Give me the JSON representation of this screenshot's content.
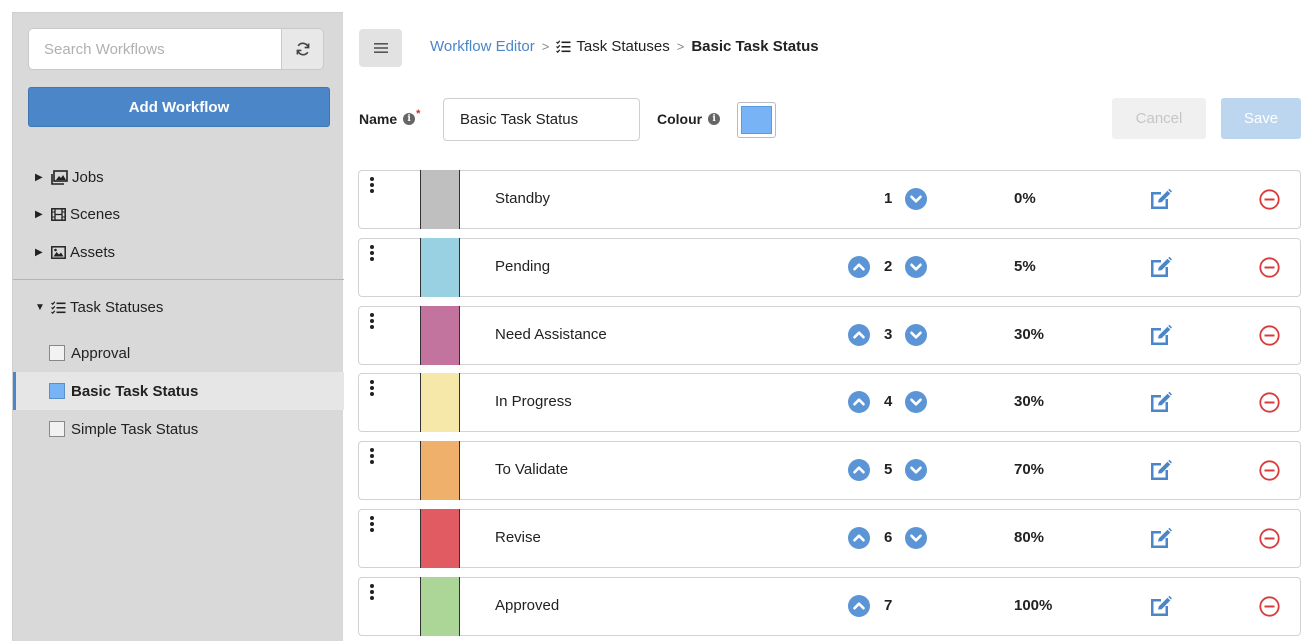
{
  "sidebar": {
    "search": {
      "placeholder": "Search Workflows",
      "value": ""
    },
    "add_workflow_label": "Add Workflow",
    "tree": [
      {
        "label": "Jobs",
        "icon": "image-stack-icon",
        "expanded": false
      },
      {
        "label": "Scenes",
        "icon": "film-icon",
        "expanded": false
      },
      {
        "label": "Assets",
        "icon": "image-icon",
        "expanded": false
      }
    ],
    "task_statuses": {
      "label": "Task Statuses",
      "icon": "checklist-icon",
      "expanded": true
    },
    "workflows": [
      {
        "label": "Approval",
        "active": false
      },
      {
        "label": "Basic Task Status",
        "active": true,
        "color": "#78b4f5"
      },
      {
        "label": "Simple Task Status",
        "active": false
      }
    ]
  },
  "breadcrumb": {
    "root": "Workflow Editor",
    "middle": "Task Statuses",
    "current": "Basic Task Status"
  },
  "form": {
    "name_label": "Name",
    "required_mark": "*",
    "name_value": "Basic Task Status",
    "colour_label": "Colour",
    "colour_value": "#78b4f5",
    "cancel_label": "Cancel",
    "save_label": "Save"
  },
  "statuses": [
    {
      "name": "Standby",
      "order": "1",
      "percent": "0%",
      "color": "#bfbfbf",
      "can_up": false,
      "can_down": true
    },
    {
      "name": "Pending",
      "order": "2",
      "percent": "5%",
      "color": "#99d1e3",
      "can_up": true,
      "can_down": true
    },
    {
      "name": "Need Assistance",
      "order": "3",
      "percent": "30%",
      "color": "#c2749f",
      "can_up": true,
      "can_down": true
    },
    {
      "name": "In Progress",
      "order": "4",
      "percent": "30%",
      "color": "#f6e8a8",
      "can_up": true,
      "can_down": true
    },
    {
      "name": "To Validate",
      "order": "5",
      "percent": "70%",
      "color": "#eeb06a",
      "can_up": true,
      "can_down": true
    },
    {
      "name": "Revise",
      "order": "6",
      "percent": "80%",
      "color": "#e05c62",
      "can_up": true,
      "can_down": true
    },
    {
      "name": "Approved",
      "order": "7",
      "percent": "100%",
      "color": "#acd698",
      "can_up": true,
      "can_down": false
    }
  ],
  "colors": {
    "accent": "#4a86c8",
    "danger": "#d93b3b",
    "arrow": "#5b95d6"
  }
}
